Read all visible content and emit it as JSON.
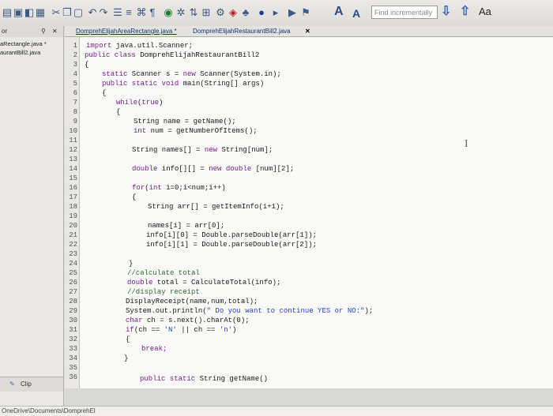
{
  "toolbar": {
    "font_increase": "A",
    "font_decrease": "A",
    "find_placeholder": "Find incrementally",
    "find_next_icon": "arrow-down-icon",
    "find_prev_icon": "arrow-up-icon",
    "match_case": "Aa"
  },
  "left_panel": {
    "header_fragment": "or",
    "items": [
      "aRectangle.java *",
      "aurantBill2.java"
    ],
    "bottom_tab": "Clip"
  },
  "tabs": [
    {
      "label": "DomprehElijahAreaRectangle.java *"
    },
    {
      "label": "DomprehElijahRestaurantBill2.java"
    }
  ],
  "tab_close": "✕",
  "line_numbers": [
    "1",
    "2",
    "3",
    "4",
    "5",
    "6",
    "7",
    "8",
    "9",
    "10",
    "11",
    "12",
    "13",
    "14",
    "15",
    "16",
    "17",
    "18",
    "19",
    "20",
    "21",
    "22",
    "23",
    "24",
    "25",
    "26",
    "27",
    "28",
    "29",
    "30",
    "31",
    "32",
    "33",
    "34",
    "35",
    "36"
  ],
  "code": {
    "l1": "import java.util.Scanner;",
    "l2": "public class DomprehElijahRestaurantBill2",
    "l3": "{",
    "l4": "static Scanner s = new Scanner(System.in);",
    "l5": "public static void main(String[] args)",
    "l6": "{",
    "l7": "while(true)",
    "l8": "{",
    "l9": "String name = getName();",
    "l10": "int num = getNumberOfItems();",
    "l12": "String names[] = new String[num];",
    "l14": "double info[][] = new double [num][2];",
    "l16": "for(int i=0;i<num;i++)",
    "l17": "{",
    "l18": "String arr[] = getItemInfo(i+1);",
    "l20": "names[i] = arr[0];",
    "l21": "info[i][0] = Double.parseDouble(arr[1]);",
    "l22": "info[i][1] = Double.parseDouble(arr[2]);",
    "l24": "}",
    "l25": "//calculate total",
    "l26": "double total = CalculateTotal(info);",
    "l27": "//display receipt",
    "l28": "DisplayReceipt(name,num,total);",
    "l29": "System.out.println(\" Do you want to continue YES or NO:\");",
    "l30": "char ch = s.next().charAt(0);",
    "l31": "if(ch == 'N' || ch == 'n')",
    "l32": "{",
    "l33": "break;",
    "l34": "}",
    "l36": "public static String getName()"
  },
  "path_bar": "OneDrive\\Documents\\DomprehEl"
}
